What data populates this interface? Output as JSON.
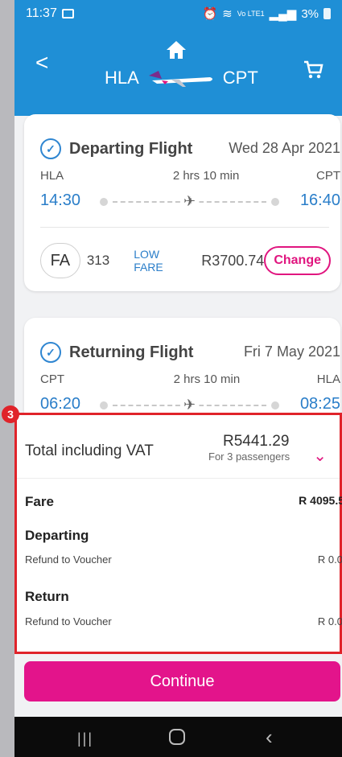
{
  "status": {
    "time": "11:37",
    "right_text": "3%",
    "network_label": "Vo LTE1"
  },
  "header": {
    "origin": "HLA",
    "destination": "CPT"
  },
  "departing": {
    "title": "Departing Flight",
    "date": "Wed 28 Apr 2021",
    "from": "HLA",
    "duration": "2 hrs 10 min",
    "to": "CPT",
    "dep_time": "14:30",
    "arr_time": "16:40",
    "airline": "FA",
    "flight_no": "313",
    "fare_type": "LOW FARE",
    "fare": "R3700.74",
    "change_label": "Change"
  },
  "returning": {
    "title": "Returning Flight",
    "date": "Fri 7 May 2021",
    "from": "CPT",
    "duration": "2 hrs 10 min",
    "to": "HLA",
    "dep_time": "06:20",
    "arr_time": "08:25"
  },
  "annotation": {
    "badge": "3"
  },
  "summary": {
    "total_label": "Total including VAT",
    "total_amount": "R5441.29",
    "passengers": "For 3 passengers",
    "fare_label": "Fare",
    "fare_value": "R 4095.5",
    "departing_label": "Departing",
    "departing_line": "Refund to Voucher",
    "departing_value": "R 0.0",
    "return_label": "Return",
    "return_line": "Refund to Voucher",
    "return_value": "R 0.0"
  },
  "continue_label": "Continue",
  "colors": {
    "primary_blue": "#1f8fd6",
    "accent_pink": "#e3148b",
    "annotation_red": "#e0232a"
  },
  "icons": [
    "home-icon",
    "cart-icon",
    "back-arrow-icon",
    "check-circle-icon",
    "plane-icon",
    "chevron-down-icon"
  ]
}
